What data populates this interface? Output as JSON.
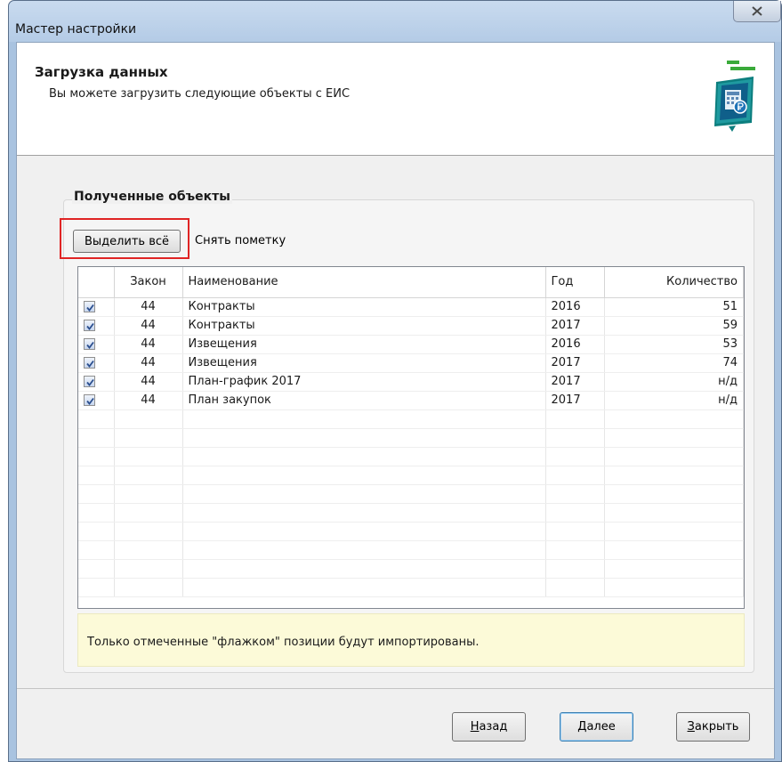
{
  "window": {
    "title": "Мастер настройки",
    "close_icon": "close-x-icon"
  },
  "header": {
    "title": "Загрузка данных",
    "subtitle": "Вы можете загрузить следующие объекты с ЕИС",
    "icon": "document-calculator-icon"
  },
  "group": {
    "title": "Полученные объекты",
    "select_all_label": "Выделить всё",
    "unmark_label": "Снять пометку"
  },
  "table": {
    "columns": {
      "law": "Закон",
      "name": "Наименование",
      "year": "Год",
      "qty": "Количество"
    },
    "rows": [
      {
        "checked": true,
        "law": "44",
        "name": "Контракты",
        "year": "2016",
        "qty": "51"
      },
      {
        "checked": true,
        "law": "44",
        "name": "Контракты",
        "year": "2017",
        "qty": "59"
      },
      {
        "checked": true,
        "law": "44",
        "name": "Извещения",
        "year": "2016",
        "qty": "53"
      },
      {
        "checked": true,
        "law": "44",
        "name": "Извещения",
        "year": "2017",
        "qty": "74"
      },
      {
        "checked": true,
        "law": "44",
        "name": "План-график 2017",
        "year": "2017",
        "qty": "н/д"
      },
      {
        "checked": true,
        "law": "44",
        "name": "План закупок",
        "year": "2017",
        "qty": "н/д"
      }
    ],
    "empty_rows": 10
  },
  "info": {
    "text": "Только отмеченные \"флажком\" позиции будут импортированы."
  },
  "footer": {
    "back": {
      "hotkey": "Н",
      "rest": "азад"
    },
    "next": {
      "hotkey": "Д",
      "rest": "алее"
    },
    "close": {
      "hotkey": "З",
      "rest": "акрыть"
    }
  },
  "colors": {
    "highlight": "#e02424",
    "info_background": "#fcfad8",
    "titlebar": "#b4cbe6"
  }
}
